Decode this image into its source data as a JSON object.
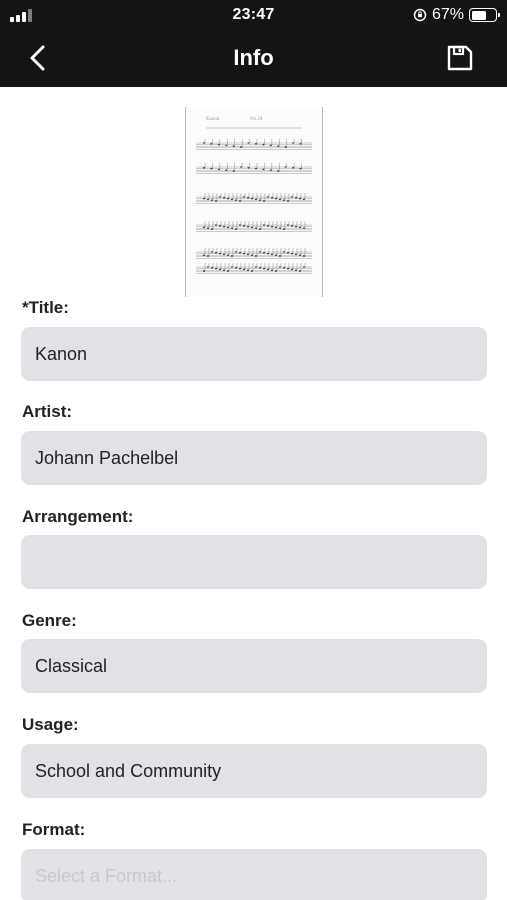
{
  "status_bar": {
    "time": "23:47",
    "battery_percent": "67%",
    "battery_level": 0.67,
    "icons": [
      "signal-icon",
      "orientation-lock-icon",
      "battery-icon"
    ]
  },
  "nav": {
    "title": "Info",
    "back_icon": "chevron-left-icon",
    "save_icon": "floppy-disk-save-icon"
  },
  "thumbnail": {
    "description_icon": "sheet-music-thumbnail",
    "header_line_1": "Kanon",
    "header_line_2": "No.24"
  },
  "form": {
    "title": {
      "label": "*Title:",
      "value": "Kanon"
    },
    "artist": {
      "label": "Artist:",
      "value": "Johann Pachelbel"
    },
    "arrangement": {
      "label": "Arrangement:",
      "value": ""
    },
    "genre": {
      "label": "Genre:",
      "value": "Classical"
    },
    "usage": {
      "label": "Usage:",
      "value": "School and Community"
    },
    "format": {
      "label": "Format:",
      "value": "",
      "placeholder": "Select a Format..."
    }
  },
  "colors": {
    "bar_background": "#141414",
    "input_background": "#e2e2e6",
    "placeholder": "#c6c6cb"
  }
}
